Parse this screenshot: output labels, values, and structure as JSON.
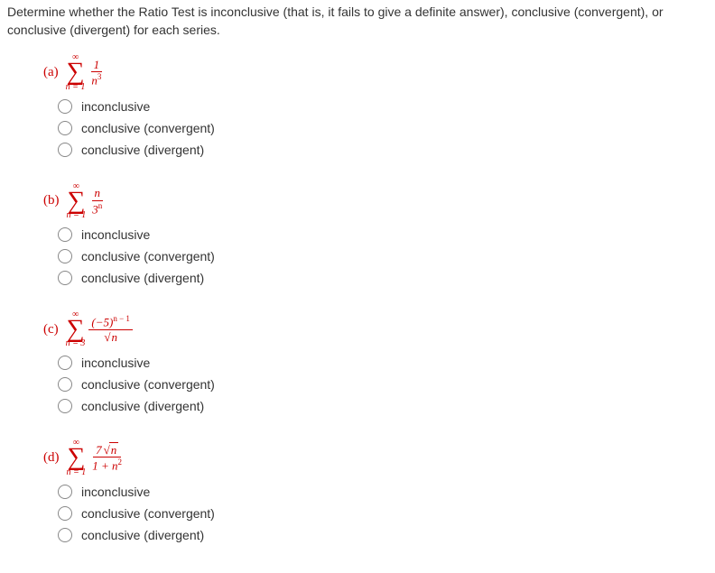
{
  "instructions": "Determine whether the Ratio Test is inconclusive (that is, it fails to give a definite answer), conclusive (convergent), or conclusive (divergent) for each series.",
  "sigma": {
    "top": "∞",
    "bottom": "n = 1",
    "bottom_c": "n = 3"
  },
  "questions": [
    {
      "label": "(a)",
      "frac_num": "1",
      "frac_den_html": "n<sup>3</sup>",
      "bottom_key": "bottom"
    },
    {
      "label": "(b)",
      "frac_num_html": "n",
      "frac_den_html": "3<sup>n</sup>",
      "bottom_key": "bottom"
    },
    {
      "label": "(c)",
      "frac_num_html": "(−5)<sup>n − 1</sup>",
      "frac_den_sqrt": "n",
      "bottom_key": "bottom_c"
    },
    {
      "label": "(d)",
      "frac_num_html": "7<span class='sqrt'><span class='sqrt-inner'>n</span></span>",
      "frac_den_html": "1 + n<sup>2</sup>",
      "bottom_key": "bottom"
    }
  ],
  "options": [
    "inconclusive",
    "conclusive (convergent)",
    "conclusive (divergent)"
  ]
}
